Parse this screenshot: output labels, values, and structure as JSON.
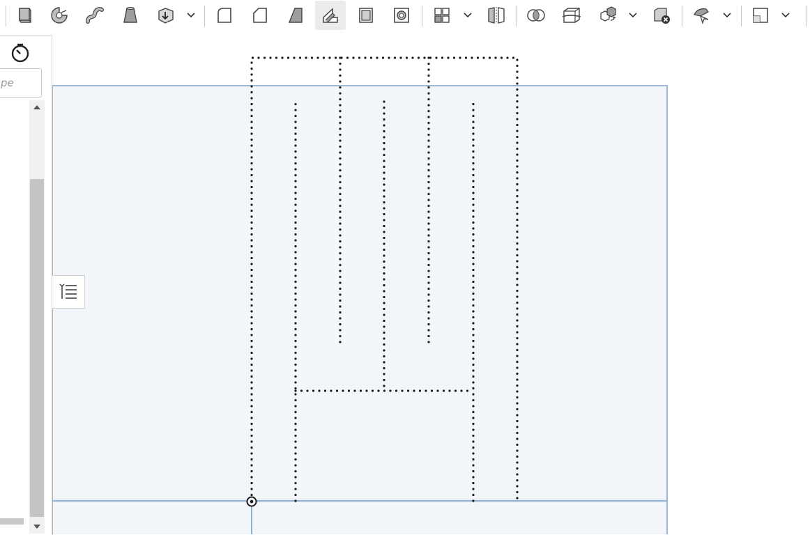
{
  "toolbar": {
    "tools": [
      {
        "name": "extrude-icon"
      },
      {
        "name": "revolve-icon"
      },
      {
        "name": "sweep-icon"
      },
      {
        "name": "loft-icon"
      },
      {
        "name": "thicken-icon"
      },
      {
        "name": "fillet-icon"
      },
      {
        "name": "chamfer-icon"
      },
      {
        "name": "draft-icon"
      },
      {
        "name": "rib-icon",
        "active": true
      },
      {
        "name": "shell-icon"
      },
      {
        "name": "hole-icon"
      },
      {
        "name": "pattern-icon"
      },
      {
        "name": "mirror-icon"
      },
      {
        "name": "boolean-icon"
      },
      {
        "name": "split-icon"
      },
      {
        "name": "transform-icon"
      },
      {
        "name": "delete-part-icon"
      },
      {
        "name": "modify-fillet-icon"
      },
      {
        "name": "plane-icon"
      }
    ]
  },
  "feature_panel": {
    "history_icon": "stopwatch-icon",
    "search_placeholder": "pe"
  },
  "outline_toggle": {
    "icon": "list-outline-icon"
  },
  "colors": {
    "plane_fill": "#f2f6fa",
    "plane_edge": "#9fb9d5",
    "sketch_dots": "#1a1a1a",
    "active_tool_bg": "#ebebeb"
  }
}
